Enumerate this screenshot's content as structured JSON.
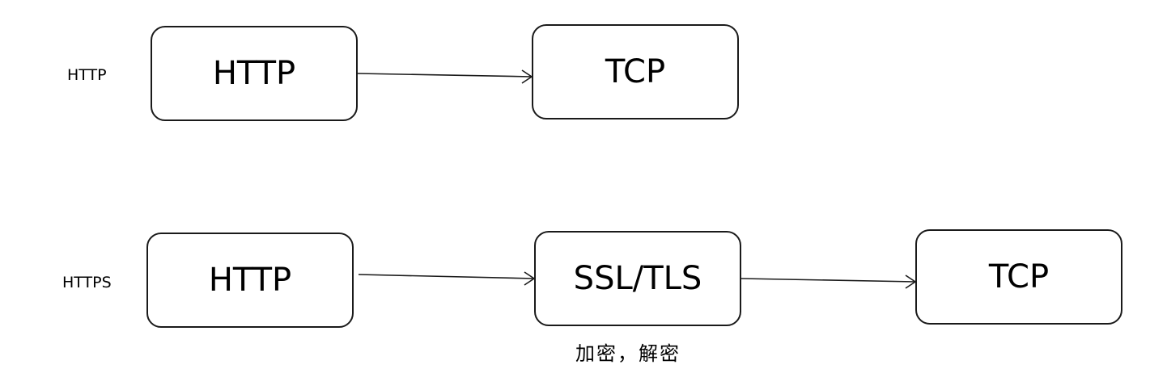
{
  "rows": {
    "http": {
      "label": "HTTP",
      "nodes": [
        "HTTP",
        "TCP"
      ]
    },
    "https": {
      "label": "HTTPS",
      "nodes": [
        "HTTP",
        "SSL/TLS",
        "TCP"
      ],
      "ssl_note": "加密，解密"
    }
  }
}
